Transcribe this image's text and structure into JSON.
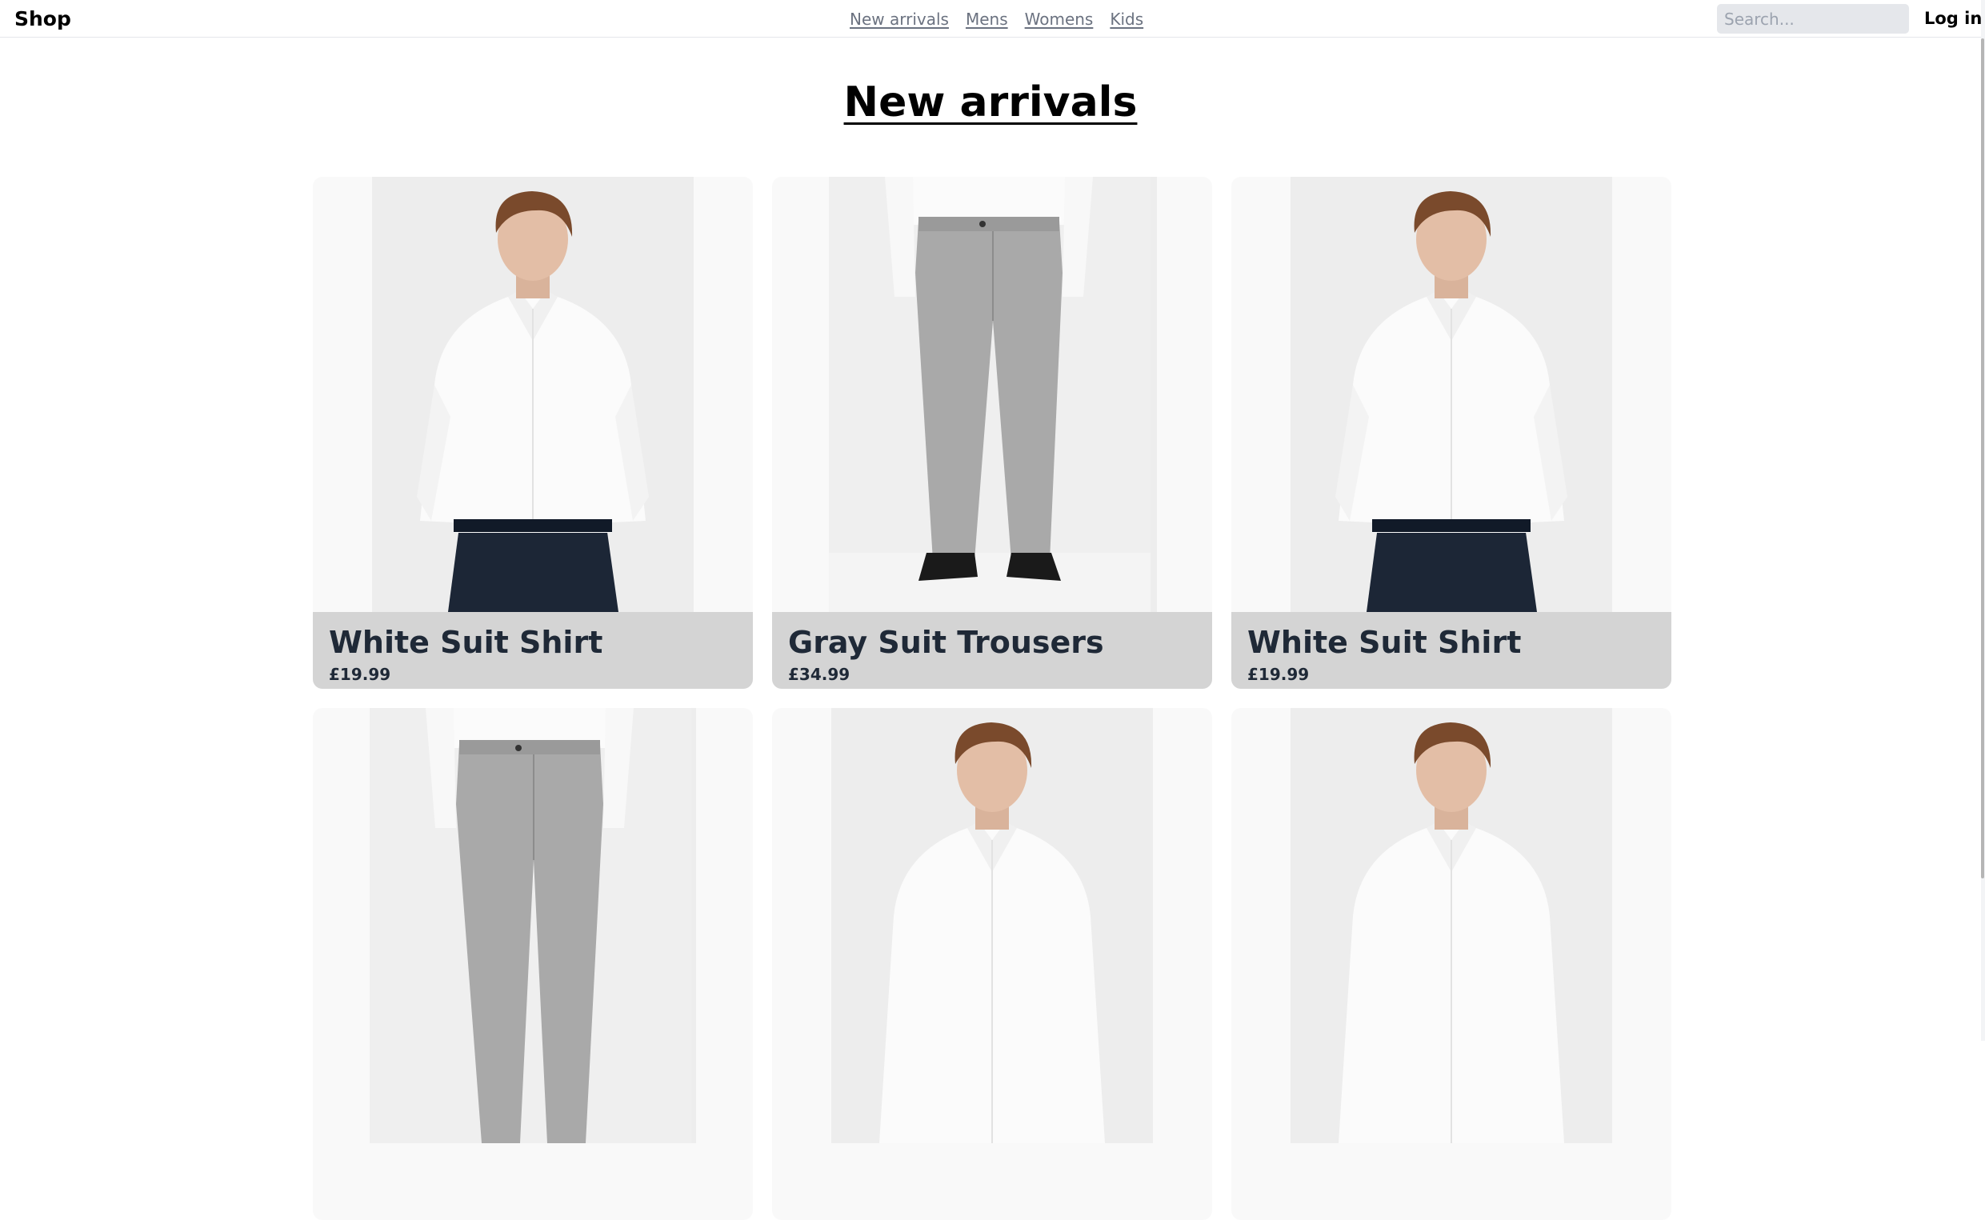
{
  "header": {
    "brand": "Shop",
    "nav": [
      "New arrivals",
      "Mens",
      "Womens",
      "Kids"
    ],
    "search_placeholder": "Search...",
    "login": "Log in"
  },
  "page": {
    "title": "New arrivals"
  },
  "products": [
    {
      "name": "White Suit Shirt",
      "price": "£19.99",
      "image": "shirt"
    },
    {
      "name": "Gray Suit Trousers",
      "price": "£34.99",
      "image": "trousers"
    },
    {
      "name": "White Suit Shirt",
      "price": "£19.99",
      "image": "shirt"
    },
    {
      "name": "",
      "price": "",
      "image": "trousers"
    },
    {
      "name": "",
      "price": "",
      "image": "shirt"
    },
    {
      "name": "",
      "price": "",
      "image": "shirt"
    }
  ]
}
